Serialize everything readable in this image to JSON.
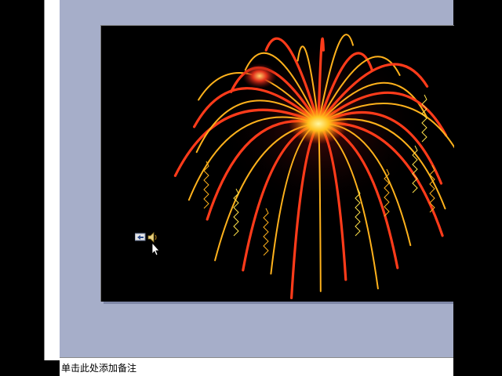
{
  "notes_pane": {
    "placeholder": "单击此处添加备注"
  },
  "slide": {
    "background_color": "#000000",
    "firework_colors": [
      "#ff3b1a",
      "#ffb21c",
      "#ffe24a",
      "#c21c10"
    ]
  },
  "app": {
    "pane_background": "#a6aec9"
  },
  "icons": [
    "sound-icon",
    "return-button-icon",
    "move-cursor-icon"
  ]
}
